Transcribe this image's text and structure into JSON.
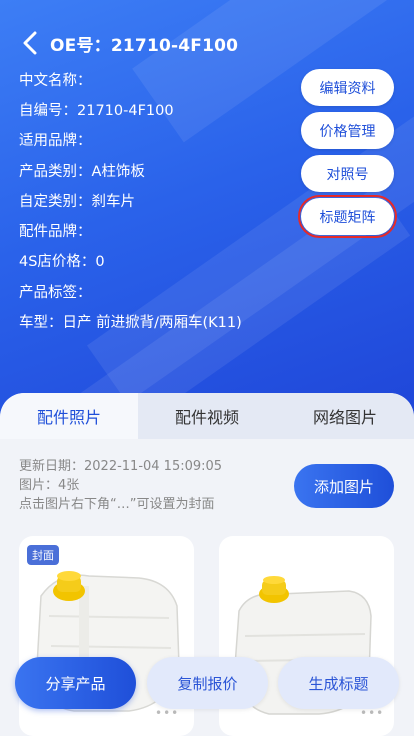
{
  "header": {
    "title": "OE号：21710-4F100",
    "back_icon": "chevron-left-icon"
  },
  "info": [
    "中文名称：",
    "自编号：21710-4F100",
    "适用品牌：",
    "产品类别：A柱饰板",
    "自定类别：刹车片",
    "配件品牌：",
    "4S店价格：0",
    "产品标签：",
    "车型：日产 前进掀背/两厢车(K11)"
  ],
  "side_buttons": [
    "编辑资料",
    "价格管理",
    "对照号",
    "标题矩阵"
  ],
  "tabs": [
    {
      "label": "配件照片",
      "active": true
    },
    {
      "label": "配件视频",
      "active": false
    },
    {
      "label": "网络图片",
      "active": false
    }
  ],
  "photos_meta": {
    "update_date": "更新日期：2022-11-04 15:09:05",
    "count": "图片：4张",
    "hint": "点击图片右下角“…”可设置为封面"
  },
  "add_image_label": "添加图片",
  "cover_badge": "封面",
  "bottom": {
    "share": "分享产品",
    "copy_quote": "复制报价",
    "generate_title": "生成标题"
  },
  "more_dots": "•••",
  "colors": {
    "primary": "#1f4fd9",
    "highlight_border": "#e52a2a",
    "cap_yellow": "#f2c400"
  }
}
